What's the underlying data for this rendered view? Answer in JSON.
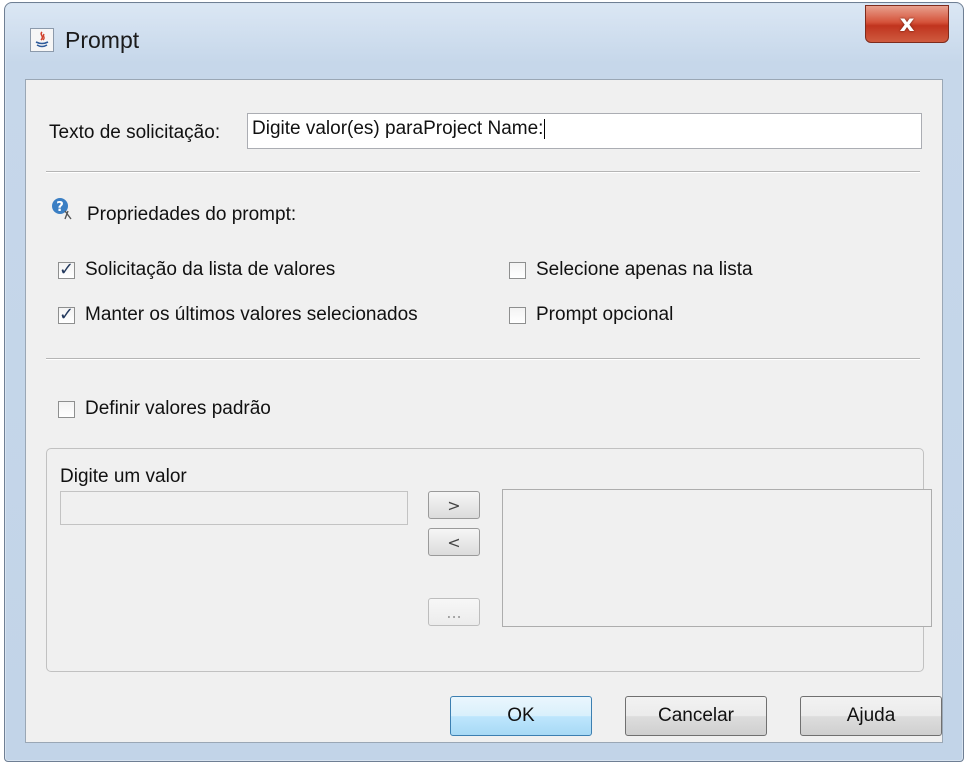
{
  "window": {
    "title": "Prompt",
    "close_label": "x",
    "app_icon": "java-icon"
  },
  "prompt_text": {
    "label": "Texto de solicitação:",
    "value": "Digite valor(es) paraProject Name:"
  },
  "properties": {
    "header": "Propriedades do prompt:",
    "header_icon": "prompt-properties-icon",
    "options": [
      {
        "label": "Solicitação da lista de valores",
        "checked": true
      },
      {
        "label": "Selecione apenas na lista",
        "checked": false
      },
      {
        "label": "Manter os últimos valores selecionados",
        "checked": true
      },
      {
        "label": "Prompt opcional",
        "checked": false
      }
    ]
  },
  "defaults": {
    "label": "Definir valores padrão",
    "checked": false
  },
  "value_group": {
    "input_label": "Digite um valor",
    "input_value": "",
    "add_label": ">",
    "remove_label": "<",
    "browse_label": "..."
  },
  "buttons": {
    "ok": "OK",
    "cancel": "Cancelar",
    "help": "Ajuda"
  },
  "colors": {
    "close_button": "#c7412a",
    "default_button": "#bee6fd",
    "dialog_bg": "#f0f0f0"
  }
}
